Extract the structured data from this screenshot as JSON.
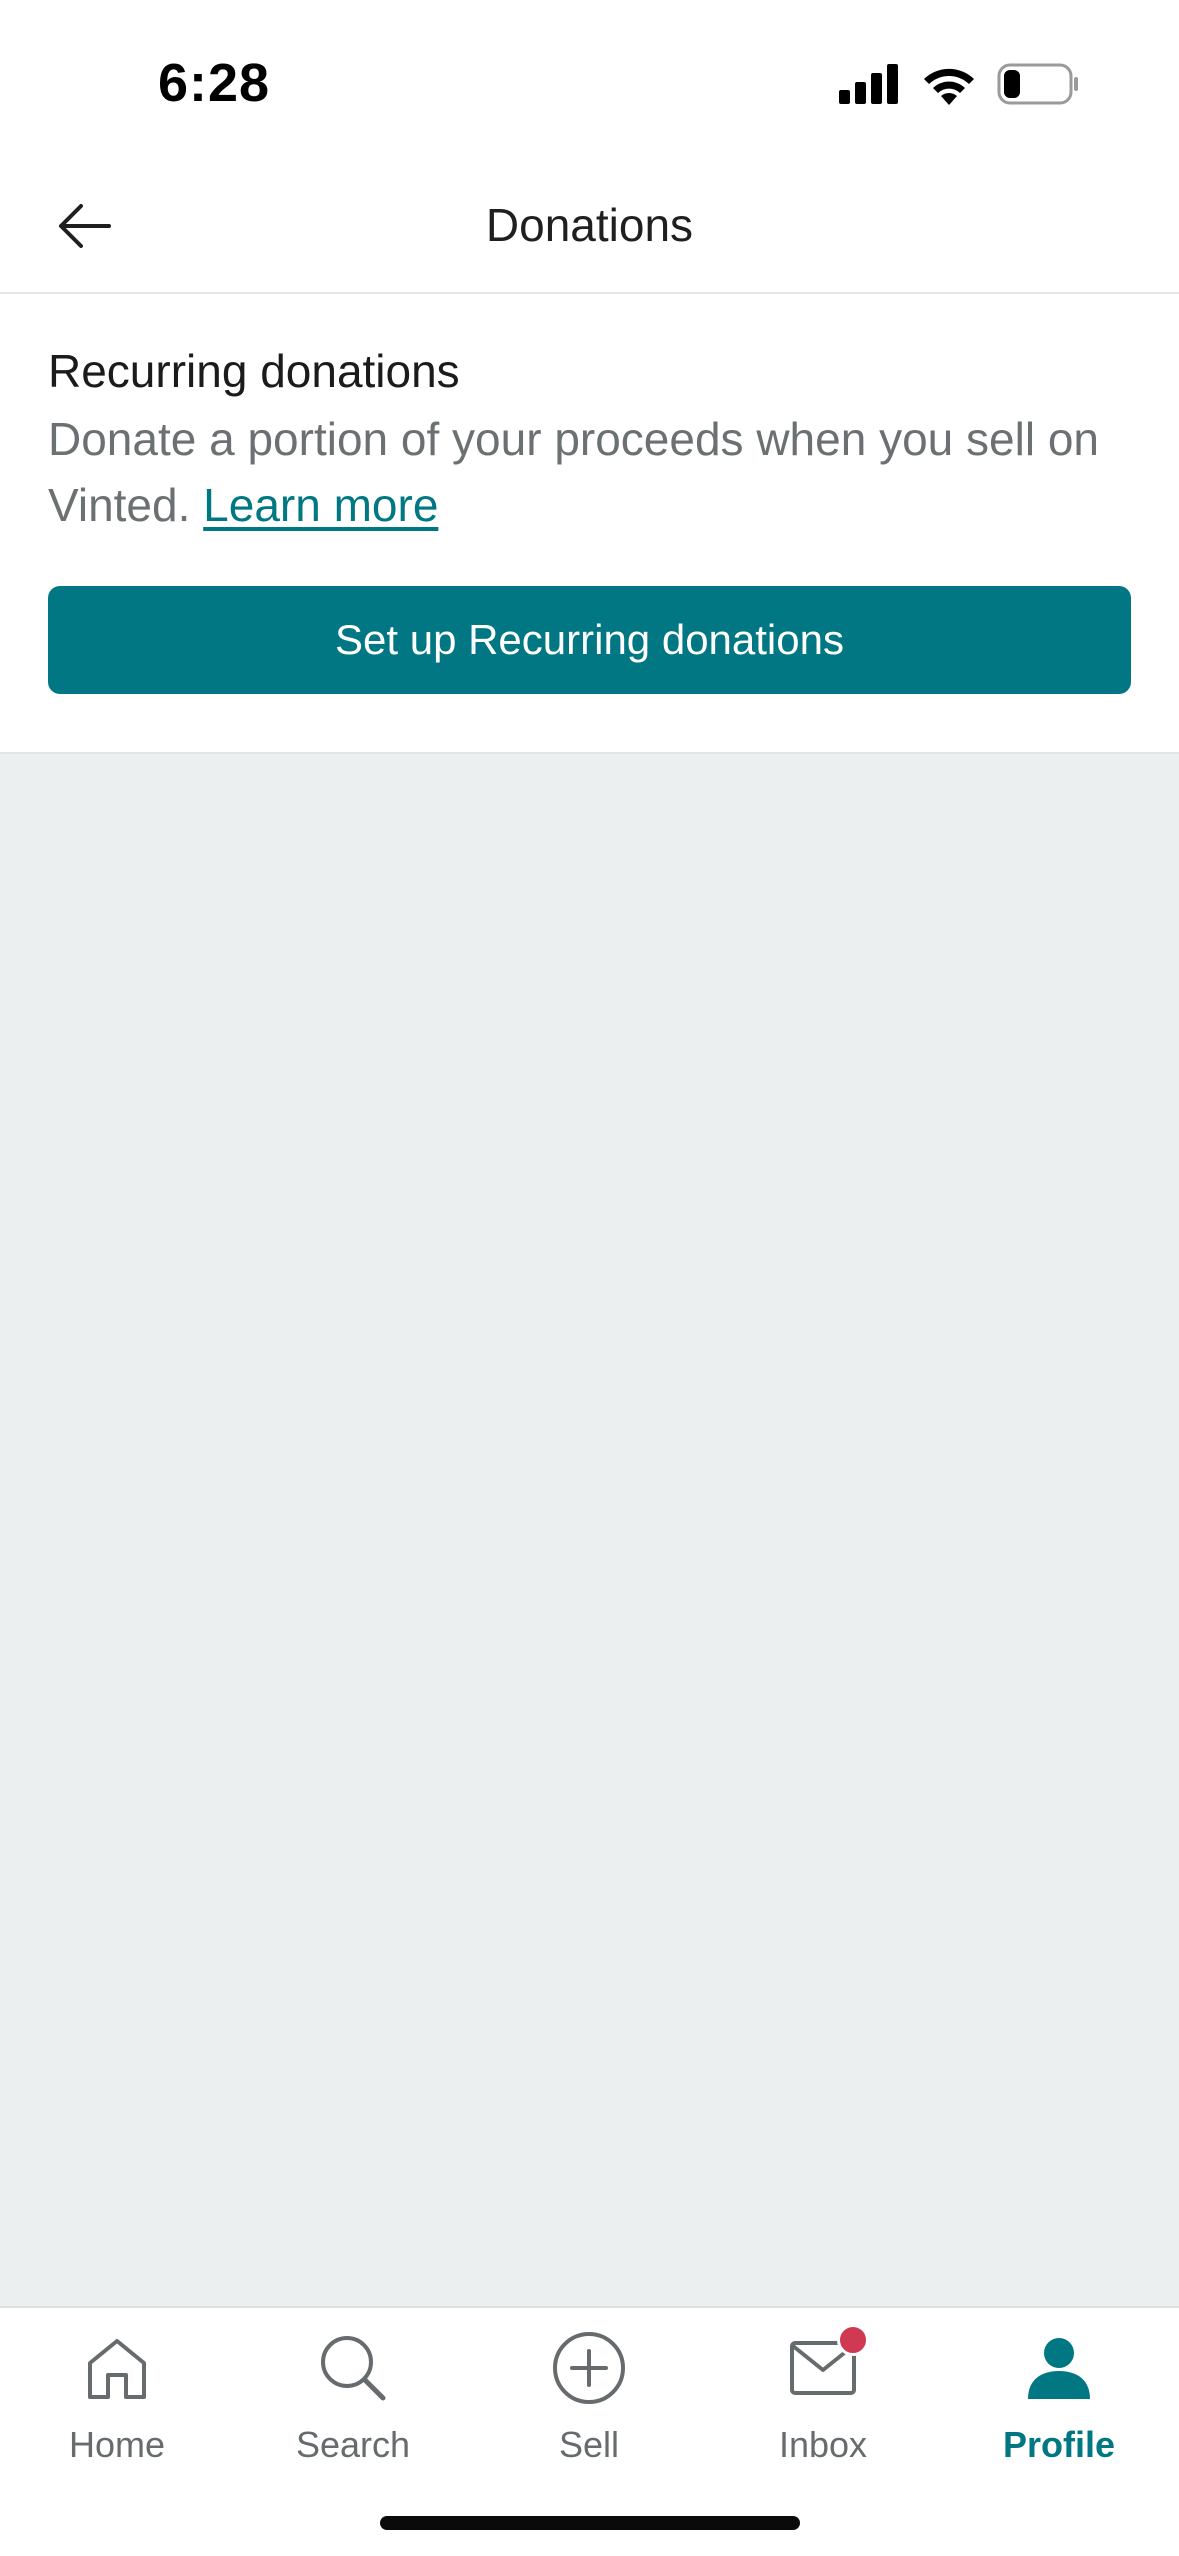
{
  "status_bar": {
    "time": "6:28",
    "icons": [
      "signal-icon",
      "wifi-icon",
      "battery-icon"
    ]
  },
  "header": {
    "title": "Donations",
    "back_icon": "arrow-left-icon"
  },
  "recurring": {
    "title": "Recurring donations",
    "description": "Donate a portion of your proceeds when you sell on Vinted.",
    "learn_more": "Learn more",
    "button_label": "Set up Recurring donations"
  },
  "tab_bar": {
    "items": [
      {
        "label": "Home",
        "icon": "home-icon"
      },
      {
        "label": "Search",
        "icon": "search-icon"
      },
      {
        "label": "Sell",
        "icon": "plus-circle-icon"
      },
      {
        "label": "Inbox",
        "icon": "mail-icon",
        "badge": true
      },
      {
        "label": "Profile",
        "icon": "user-icon",
        "active": true
      }
    ]
  },
  "colors": {
    "accent": "#007782",
    "badge": "#cf3a52",
    "background": "#eceff0"
  }
}
